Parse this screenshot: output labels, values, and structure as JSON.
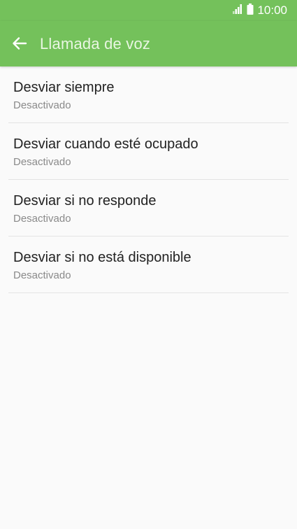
{
  "status_bar": {
    "time": "10:00",
    "icons": [
      "signal-icon",
      "battery-icon"
    ]
  },
  "app_bar": {
    "title": "Llamada de voz",
    "back_icon": "arrow-left-icon"
  },
  "colors": {
    "app_bar_bg": "#74c15b",
    "title_text": "#e9f6e2",
    "item_title": "#222222",
    "item_subtitle": "#8a8a8a",
    "divider": "#e3e3e3",
    "background": "#fafafa"
  },
  "items": [
    {
      "title": "Desviar siempre",
      "status": "Desactivado"
    },
    {
      "title": "Desviar cuando esté ocupado",
      "status": "Desactivado"
    },
    {
      "title": "Desviar si no responde",
      "status": "Desactivado"
    },
    {
      "title": "Desviar si no está disponible",
      "status": "Desactivado"
    }
  ]
}
